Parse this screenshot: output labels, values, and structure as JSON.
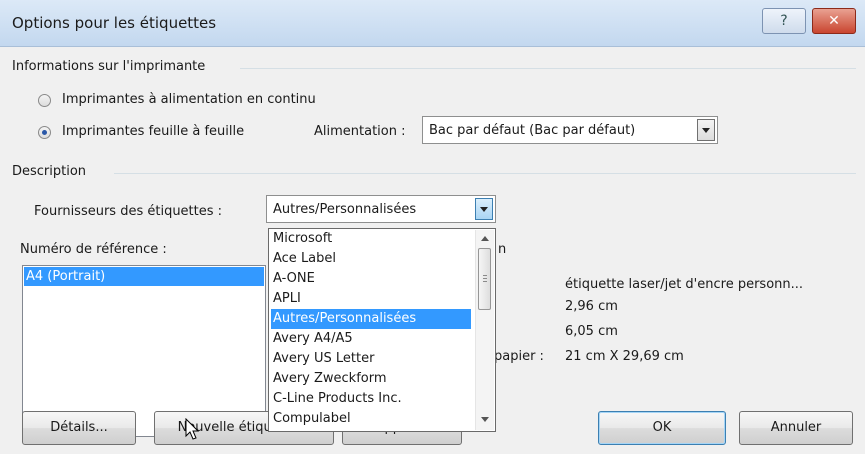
{
  "window": {
    "title": "Options pour les étiquettes",
    "help_label": "?",
    "close_label": "✕"
  },
  "printer_info": {
    "heading": "Informations sur l'imprimante",
    "radio_continuous": "Imprimantes à alimentation en continu",
    "radio_page": "Imprimantes feuille à feuille",
    "tray_label": "Alimentation :",
    "tray_value": "Bac par défaut (Bac par défaut)"
  },
  "description": {
    "heading": "Description",
    "vendor_label": "Fournisseurs des étiquettes :",
    "vendor_value": "Autres/Personnalisées",
    "ref_label": "Numéro de référence :",
    "ref_items": [
      "A4 (Portrait)"
    ],
    "info_heading_fragment": "n",
    "info_values": [
      "étiquette laser/jet d'encre personn...",
      "2,96 cm",
      "6,05 cm",
      "21 cm X 29,69 cm"
    ],
    "paper_label_fragment": "papier :"
  },
  "dropdown_items": [
    "Microsoft",
    "Ace Label",
    "A-ONE",
    "APLI",
    "Autres/Personnalisées",
    "Avery A4/A5",
    "Avery US Letter",
    "Avery Zweckform",
    "C-Line Products Inc.",
    "Compulabel"
  ],
  "selected_dropdown_index": 4,
  "buttons": {
    "details": "Détails...",
    "new_label": "Nouvelle étiquette...",
    "delete": "Supprimer",
    "ok": "OK",
    "cancel": "Annuler"
  }
}
